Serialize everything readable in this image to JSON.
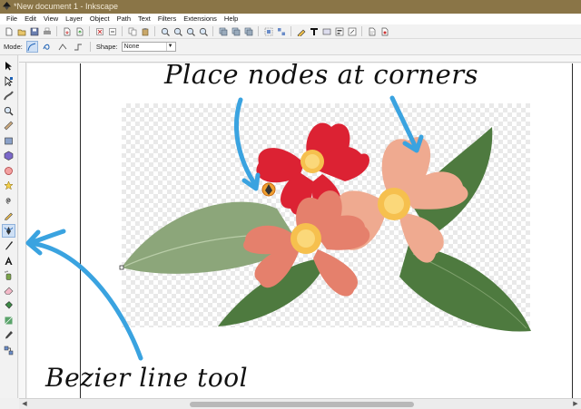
{
  "window": {
    "title": "*New document 1 - Inkscape"
  },
  "menu": [
    "File",
    "Edit",
    "View",
    "Layer",
    "Object",
    "Path",
    "Text",
    "Filters",
    "Extensions",
    "Help"
  ],
  "controls": {
    "mode_label": "Mode:",
    "shape_label": "Shape:",
    "shape_value": "None"
  },
  "annotations": {
    "top": "Place nodes at corners",
    "bottom": "Bezier line tool"
  },
  "colors": {
    "titlebar": "#8a7547",
    "annotation_arrow": "#3aa3e0",
    "petal_red": "#dc2233",
    "petal_salmon": "#e5806c",
    "petal_pink": "#efaa90",
    "leaf_dark": "#4e7a3f",
    "leaf_light": "#8ca67a",
    "flower_center": "#f6c04e"
  }
}
